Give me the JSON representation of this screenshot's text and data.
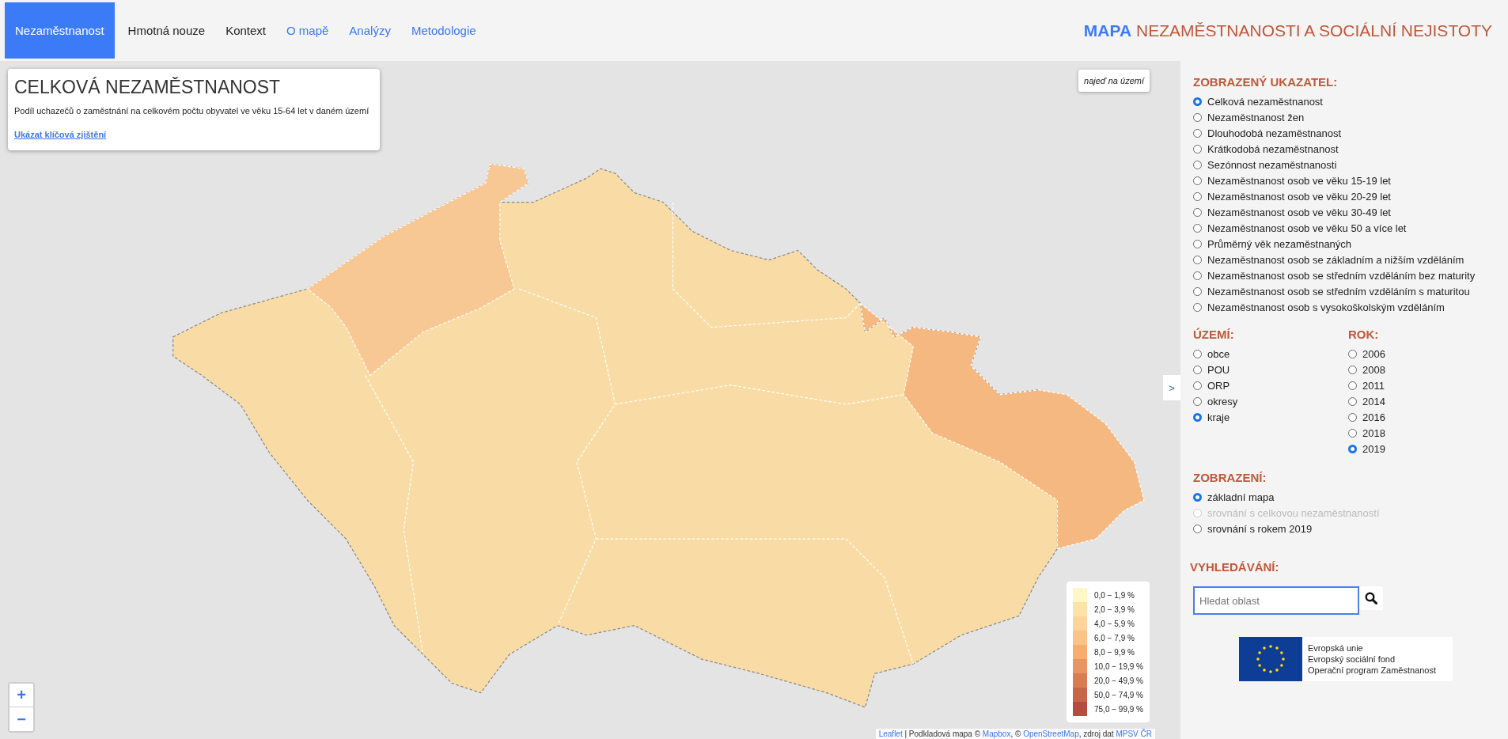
{
  "nav": {
    "tabs": [
      {
        "label": "Nezaměstnanost",
        "kind": "tab",
        "selected": true
      },
      {
        "label": "Hmotná nouze",
        "kind": "tab",
        "selected": false
      },
      {
        "label": "Kontext",
        "kind": "tab",
        "selected": false
      },
      {
        "label": "O mapě",
        "kind": "link",
        "selected": false
      },
      {
        "label": "Analýzy",
        "kind": "link",
        "selected": false
      },
      {
        "label": "Metodologie",
        "kind": "link",
        "selected": false
      }
    ],
    "title": {
      "accent": "MAPA",
      "rest": "NEZAMĚSTNANOSTI A SOCIÁLNÍ NEJISTOTY"
    }
  },
  "info_box": {
    "title": "CELKOVÁ NEZAMĚSTNANOST",
    "description": "Podíl uchazečů o zaměstnání na celkovém počtu obyvatel ve věku 15-64 let v daném území",
    "link": "Ukázat klíčová zjištění"
  },
  "map": {
    "fit_button": "najeď na území",
    "panel_toggle": ">",
    "zoom_in": "+",
    "zoom_out": "−",
    "legend": [
      {
        "label": "0,0 − 1,9 %",
        "color": "#fff7c6"
      },
      {
        "label": "2,0 − 3,9 %",
        "color": "#fde3a7"
      },
      {
        "label": "4,0 − 5,9 %",
        "color": "#fdd49a"
      },
      {
        "label": "6,0 − 7,9 %",
        "color": "#fcc387"
      },
      {
        "label": "8,0 − 9,9 %",
        "color": "#f9ad6d"
      },
      {
        "label": "10,0 − 19,9 %",
        "color": "#e99563"
      },
      {
        "label": "20,0 − 49,9 %",
        "color": "#d97b53"
      },
      {
        "label": "50,0 − 74,9 %",
        "color": "#c86548"
      },
      {
        "label": "75,0 − 99,9 %",
        "color": "#b64b3f"
      }
    ],
    "attribution": [
      {
        "text": "Leaflet",
        "kind": "link"
      },
      {
        "text": " | Podkladová mapa © ",
        "kind": "text"
      },
      {
        "text": "Mapbox",
        "kind": "link"
      },
      {
        "text": ", © ",
        "kind": "text"
      },
      {
        "text": "OpenStreetMap",
        "kind": "link"
      },
      {
        "text": ", zdroj dat ",
        "kind": "text"
      },
      {
        "text": "MPSV ČR",
        "kind": "link"
      }
    ]
  },
  "panel": {
    "indicator": {
      "heading": "ZOBRAZENÝ UKAZATEL:",
      "options": [
        {
          "label": "Celková nezaměstnanost",
          "selected": true
        },
        {
          "label": "Nezaměstnanost žen",
          "selected": false
        },
        {
          "label": "Dlouhodobá nezaměstnanost",
          "selected": false
        },
        {
          "label": "Krátkodobá nezaměstnanost",
          "selected": false
        },
        {
          "label": "Sezónnost nezaměstnanosti",
          "selected": false
        },
        {
          "label": "Nezaměstnanost osob ve věku 15-19 let",
          "selected": false
        },
        {
          "label": "Nezaměstnanost osob ve věku 20-29 let",
          "selected": false
        },
        {
          "label": "Nezaměstnanost osob ve věku 30-49 let",
          "selected": false
        },
        {
          "label": "Nezaměstnanost osob ve věku 50 a více let",
          "selected": false
        },
        {
          "label": "Průměrný věk nezaměstnaných",
          "selected": false
        },
        {
          "label": "Nezaměstnanost osob se základním a nižším vzděláním",
          "selected": false
        },
        {
          "label": "Nezaměstnanost osob se středním vzděláním bez maturity",
          "selected": false
        },
        {
          "label": "Nezaměstnanost osob se středním vzděláním s maturitou",
          "selected": false
        },
        {
          "label": "Nezaměstnanost osob s vysokoškolským vzděláním",
          "selected": false
        }
      ]
    },
    "territory": {
      "heading": "ÚZEMÍ:",
      "options": [
        {
          "label": "obce",
          "selected": false
        },
        {
          "label": "POU",
          "selected": false
        },
        {
          "label": "ORP",
          "selected": false
        },
        {
          "label": "okresy",
          "selected": false
        },
        {
          "label": "kraje",
          "selected": true
        }
      ]
    },
    "year": {
      "heading": "ROK:",
      "options": [
        {
          "label": "2006",
          "selected": false
        },
        {
          "label": "2008",
          "selected": false
        },
        {
          "label": "2011",
          "selected": false
        },
        {
          "label": "2014",
          "selected": false
        },
        {
          "label": "2016",
          "selected": false
        },
        {
          "label": "2018",
          "selected": false
        },
        {
          "label": "2019",
          "selected": true
        }
      ]
    },
    "display": {
      "heading": "ZOBRAZENÍ:",
      "options": [
        {
          "label": "základní mapa",
          "selected": true,
          "disabled": false
        },
        {
          "label": "srovnání s celkovou nezaměstnaností",
          "selected": false,
          "disabled": true
        },
        {
          "label": "srovnání s rokem 2019",
          "selected": false,
          "disabled": false
        }
      ]
    },
    "search": {
      "heading": "VYHLEDÁVÁNÍ:",
      "placeholder": "Hledat oblast"
    },
    "eu_logo": {
      "lines": [
        "Evropská unie",
        "Evropský sociální fond",
        "Operační program Zaměstnanost"
      ]
    }
  }
}
